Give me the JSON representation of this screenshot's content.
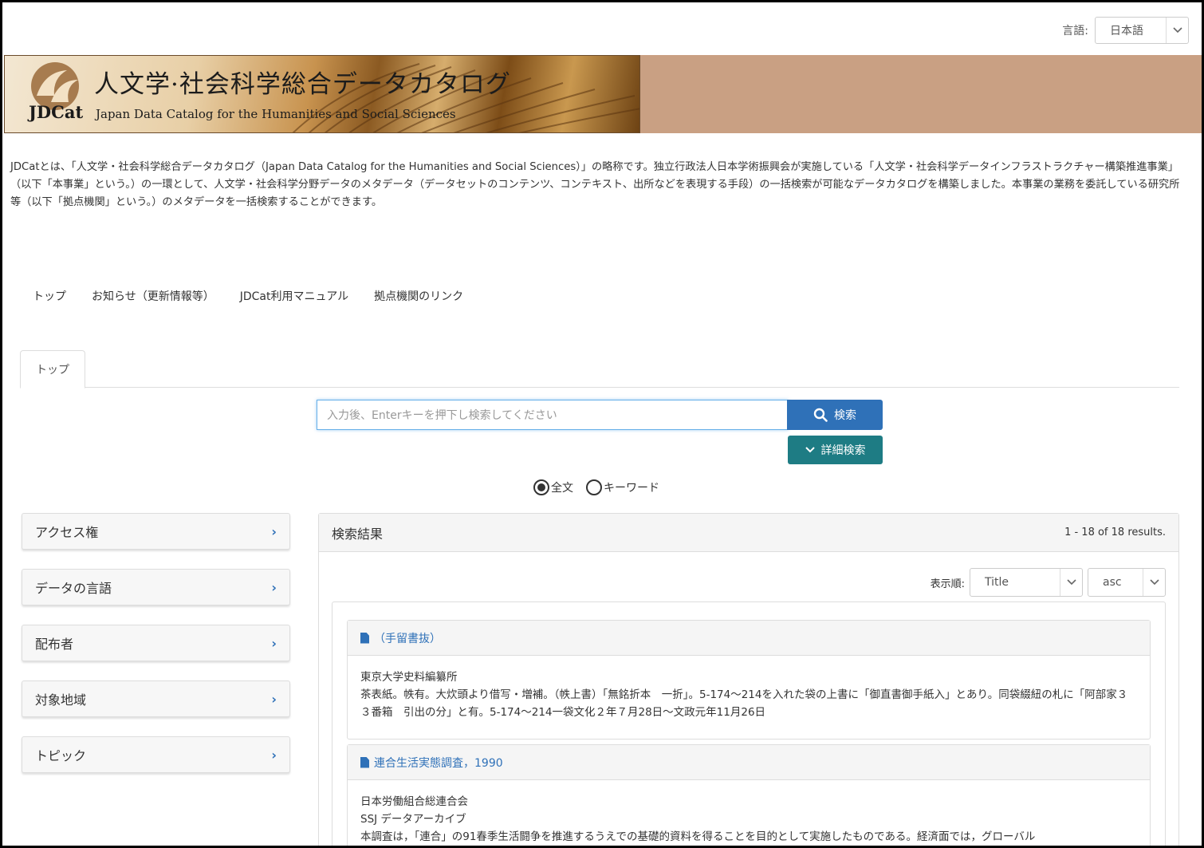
{
  "language": {
    "label": "言語:",
    "selected": "日本語"
  },
  "banner": {
    "title": "人文学·社会科学総合データカタログ",
    "subtitle": "Japan Data Catalog for the Humanities and Social Sciences",
    "brand": "JDCat"
  },
  "description": "JDCatとは、「人文学・社会科学総合データカタログ（Japan Data Catalog for the Humanities and Social Sciences）」の略称です。独立行政法人日本学術振興会が実施している「人文学・社会科学データインフラストラクチャー構築推進事業」（以下「本事業」という。）の一環として、人文学・社会科学分野データのメタデータ（データセットのコンテンツ、コンテキスト、出所などを表現する手段）の一括検索が可能なデータカタログを構築しました。本事業の業務を委託している研究所等（以下「拠点機関」という。）のメタデータを一括検索することができます。",
  "nav": [
    "トップ",
    "お知らせ（更新情報等）",
    "JDCat利用マニュアル",
    "拠点機関のリンク"
  ],
  "tab": "トップ",
  "search": {
    "placeholder": "入力後、Enterキーを押下し検索してください",
    "button": "検索",
    "detail_button": "詳細検索",
    "radio_fulltext": "全文",
    "radio_keyword": "キーワード"
  },
  "facets": [
    "アクセス権",
    "データの言語",
    "配布者",
    "対象地域",
    "トピック"
  ],
  "results": {
    "title": "検索結果",
    "count": "1 - 18 of 18 results.",
    "sort_label": "表示順:",
    "sort_field": "Title",
    "sort_order": "asc",
    "items": [
      {
        "title": "（手留書抜）",
        "lines": [
          "東京大学史料編纂所",
          "茶表紙。帙有。大炊頭より借写・増補。（帙上書）「無銘折本　一折」。5-174～214を入れた袋の上書に「御直書御手紙入」とあり。同袋綴紐の札に「阿部家３３番箱　引出の分」と有。5-174～214一袋文化２年７月28日～文政元年11月26日"
        ]
      },
      {
        "title": "連合生活実態調査，1990",
        "lines": [
          "日本労働組合総連合会",
          "SSJ データアーカイブ",
          "本調査は，「連合」の91春季生活闘争を推進するうえでの基礎的資料を得ることを目的として実施したものである。経済面では，グローバル"
        ]
      }
    ]
  },
  "colors": {
    "accent": "#2f71b8",
    "teal": "#1e7c84",
    "banner_bg": "#c9a083"
  }
}
